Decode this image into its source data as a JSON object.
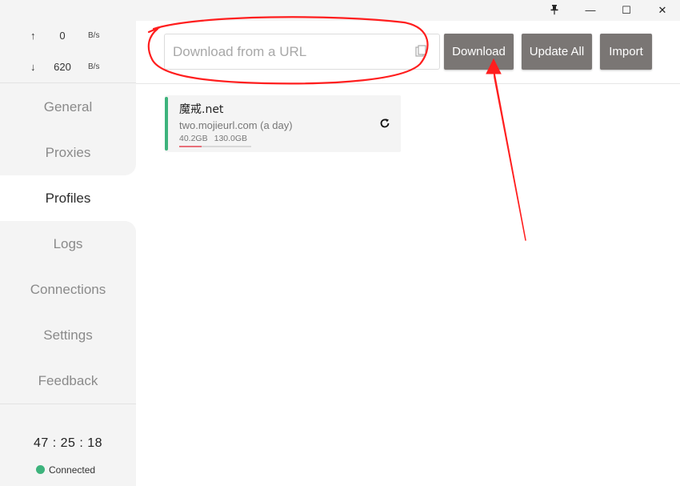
{
  "titlebar": {
    "pin_icon": "pin-icon",
    "minimize_glyph": "—",
    "maximize_glyph": "☐",
    "close_glyph": "✕"
  },
  "traffic": {
    "up_arrow": "↑",
    "up_value": "0",
    "up_unit": "B/s",
    "down_arrow": "↓",
    "down_value": "620",
    "down_unit": "B/s"
  },
  "nav": {
    "items": [
      "General",
      "Proxies",
      "Profiles",
      "Logs",
      "Connections",
      "Settings",
      "Feedback"
    ],
    "active": "Profiles"
  },
  "footer": {
    "clock": "47 : 25 : 18",
    "status": "Connected",
    "status_color": "#3db37c"
  },
  "toolbar": {
    "url_placeholder": "Download from a URL",
    "download_label": "Download",
    "update_all_label": "Update All",
    "import_label": "Import",
    "button_color": "#7a7674"
  },
  "profile": {
    "name": "魔戒.net",
    "url": "two.mojieurl.com (a day)",
    "used": "40.2GB",
    "total": "130.0GB",
    "usage_fraction": 0.31,
    "accent": "#3db37c"
  },
  "annotation": {
    "color": "#ff1e1e"
  }
}
